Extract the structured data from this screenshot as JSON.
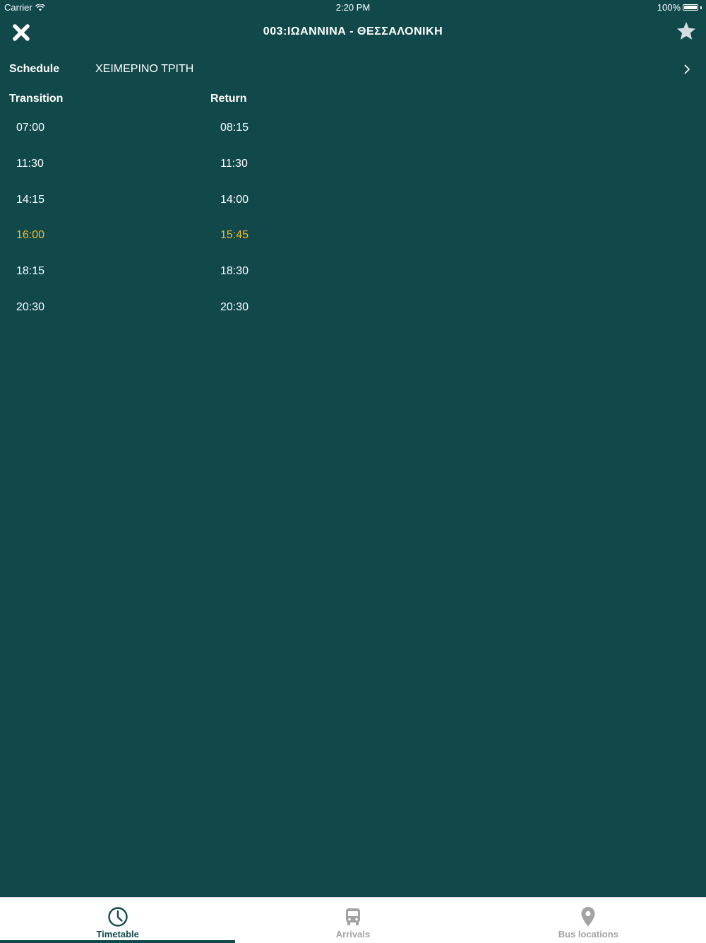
{
  "status_bar": {
    "carrier": "Carrier",
    "time": "2:20 PM",
    "battery": "100%",
    "battery_level": 1.0
  },
  "nav": {
    "title": "003:ΙΩΑΝΝΙΝΑ - ΘΕΣΣΑΛΟΝΙΚΗ",
    "close_icon": "close-icon",
    "favorite_icon": "star-icon"
  },
  "schedule": {
    "label": "Schedule",
    "value": "ΧΕΙΜΕΡΙΝΟ ΤΡΙΤΗ"
  },
  "columns": {
    "transition": "Transition",
    "return": "Return"
  },
  "transition_times": [
    {
      "time": "07:00",
      "highlighted": false
    },
    {
      "time": "11:30",
      "highlighted": false
    },
    {
      "time": "14:15",
      "highlighted": false
    },
    {
      "time": "16:00",
      "highlighted": true
    },
    {
      "time": "18:15",
      "highlighted": false
    },
    {
      "time": "20:30",
      "highlighted": false
    }
  ],
  "return_times": [
    {
      "time": "08:15",
      "highlighted": false
    },
    {
      "time": "11:30",
      "highlighted": false
    },
    {
      "time": "14:00",
      "highlighted": false
    },
    {
      "time": "15:45",
      "highlighted": true
    },
    {
      "time": "18:30",
      "highlighted": false
    },
    {
      "time": "20:30",
      "highlighted": false
    }
  ],
  "tabs": [
    {
      "label": "Timetable",
      "icon": "clock-icon",
      "active": true
    },
    {
      "label": "Arrivals",
      "icon": "bus-icon",
      "active": false
    },
    {
      "label": "Bus locations",
      "icon": "location-pin-icon",
      "active": false
    }
  ],
  "colors": {
    "background": "#11494b",
    "highlight": "#f2b92c",
    "tab_inactive": "#a3a3a3",
    "tab_active": "#11494b"
  }
}
